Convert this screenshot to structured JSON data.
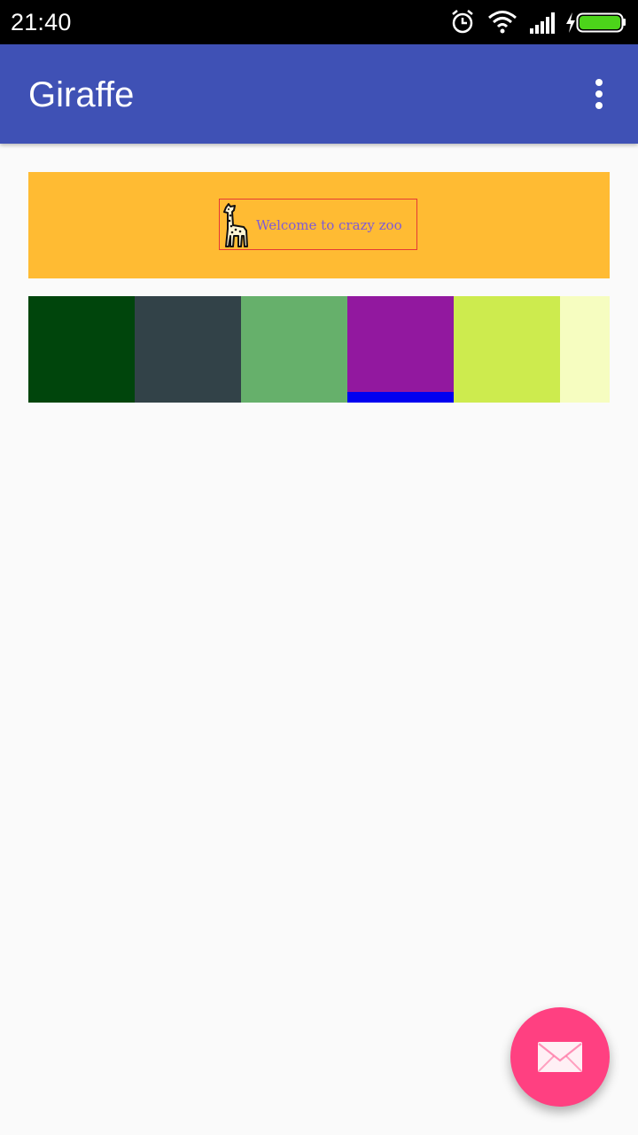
{
  "status_bar": {
    "time": "21:40",
    "icons": [
      "alarm-icon",
      "wifi-icon",
      "signal-icon",
      "charging-icon",
      "battery-icon"
    ],
    "battery_color": "#4cd41a"
  },
  "app_bar": {
    "title": "Giraffe",
    "background": "#3f51b5",
    "menu_icon": "more-vert-icon"
  },
  "banner": {
    "text": "Welcome to crazy zoo",
    "background": "#ffbb33",
    "border_color": "#e53935",
    "text_color": "#7e5bd6",
    "icon": "giraffe-icon"
  },
  "swatches": [
    {
      "color": "#00450c"
    },
    {
      "color": "#324248"
    },
    {
      "color": "#66b06b"
    },
    {
      "color": "#92189f",
      "selected": true,
      "indicator_color": "#0000f0"
    },
    {
      "color": "#cdeb4e"
    },
    {
      "color": "#f6fdc0"
    }
  ],
  "fab": {
    "icon": "email-icon",
    "color": "#ff4081"
  }
}
